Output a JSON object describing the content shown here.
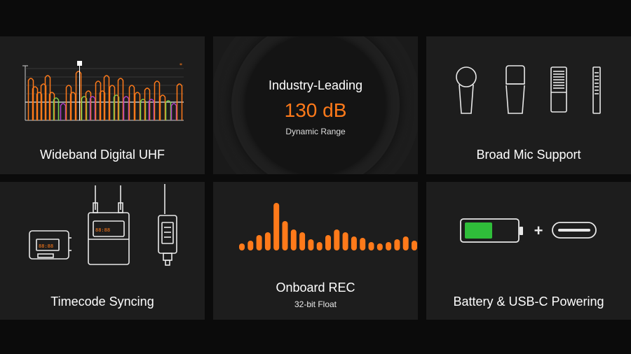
{
  "tiles": {
    "uhf": {
      "label": "Wideband Digital UHF",
      "icon": "spectrum-icon"
    },
    "range": {
      "heading": "Industry-Leading",
      "value": "130 dB",
      "caption": "Dynamic Range"
    },
    "mic": {
      "label": "Broad Mic Support",
      "icon": "microphones-icon"
    },
    "timecode": {
      "label": "Timecode Syncing",
      "icon": "transmitters-icon"
    },
    "rec": {
      "label": "Onboard REC",
      "sub": "32-bit Float",
      "icon": "waveform-icon"
    },
    "battery": {
      "label": "Battery & USB-C Powering",
      "icon": "battery-icon",
      "plus": "+"
    }
  },
  "colors": {
    "accent": "#ff7a1a",
    "battery": "#2fbe3a",
    "green": "#7ed04b",
    "purple": "#b040c8"
  }
}
